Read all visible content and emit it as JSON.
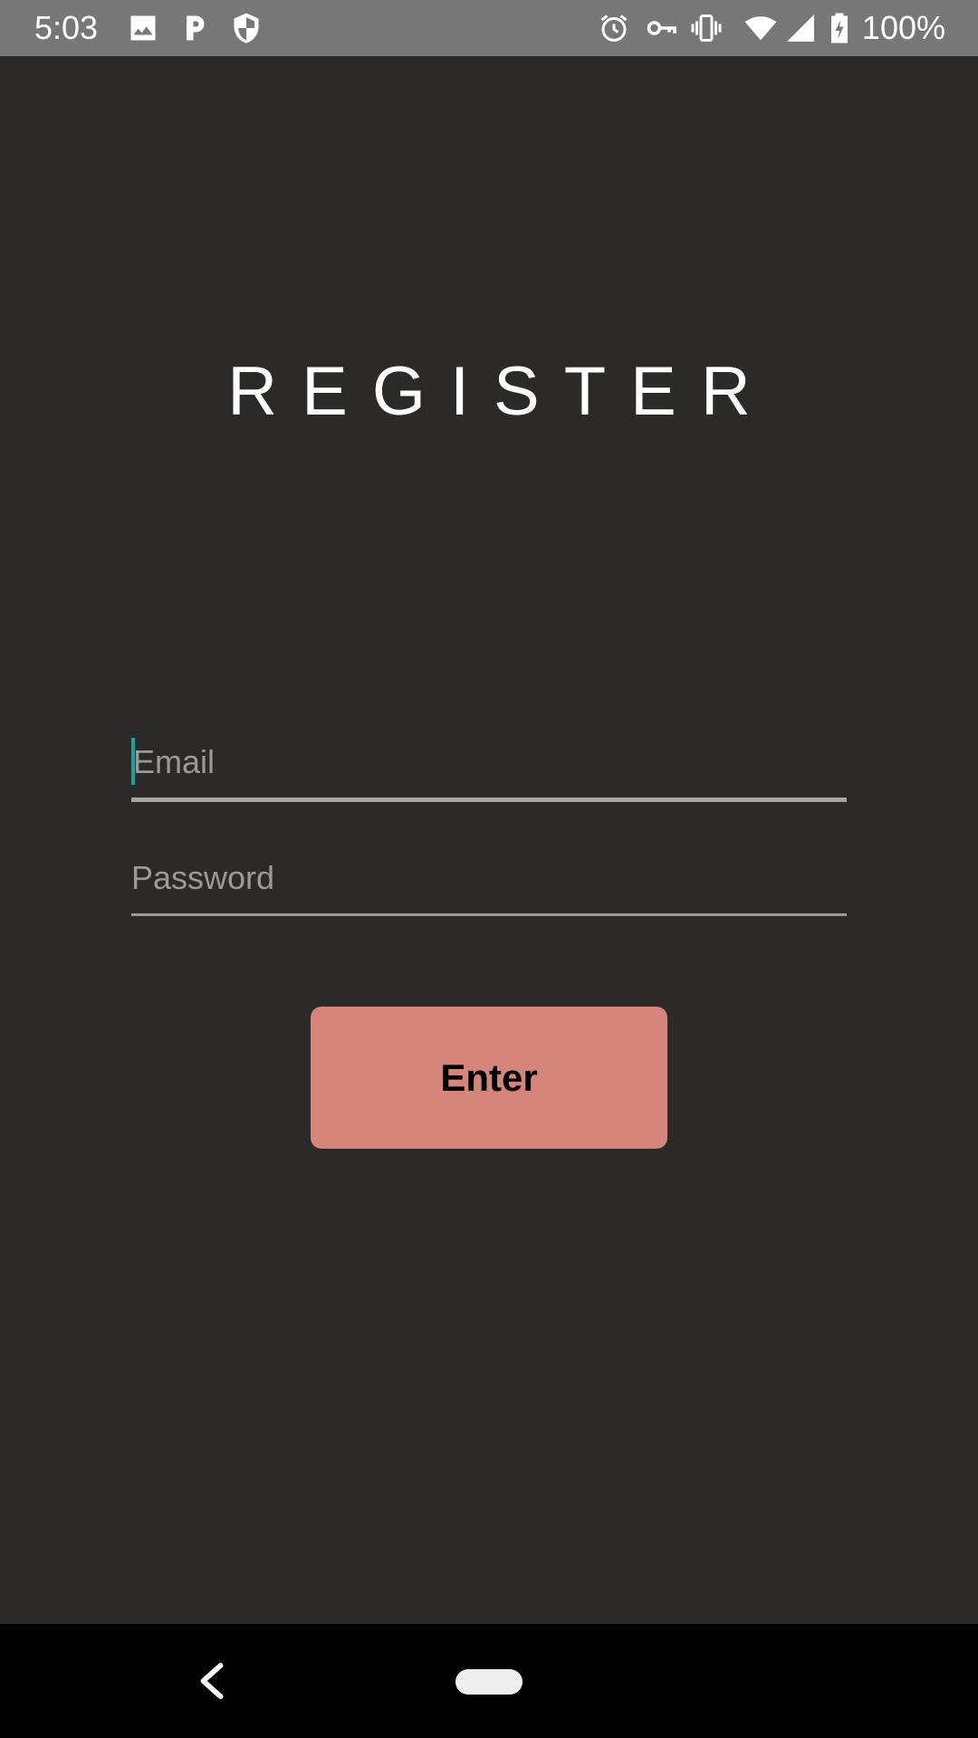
{
  "status_bar": {
    "time": "5:03",
    "battery": "100%",
    "left_icons": [
      "image-icon",
      "parking-icon",
      "shield-icon"
    ],
    "right_icons": [
      "alarm-icon",
      "vpn-key-icon",
      "vibrate-icon",
      "wifi-icon",
      "cell-signal-icon",
      "battery-charging-icon"
    ]
  },
  "page": {
    "title": "REGISTER"
  },
  "form": {
    "email_placeholder": "Email",
    "password_placeholder": "Password",
    "submit_label": "Enter"
  },
  "navigation": {
    "icons": [
      "back-icon",
      "home-pill-icon"
    ]
  },
  "colors": {
    "background": "#2c2a29",
    "status_bar": "#777777",
    "button": "#d5857a",
    "cursor_accent": "#1aa39a",
    "nav_bar": "#000000"
  }
}
